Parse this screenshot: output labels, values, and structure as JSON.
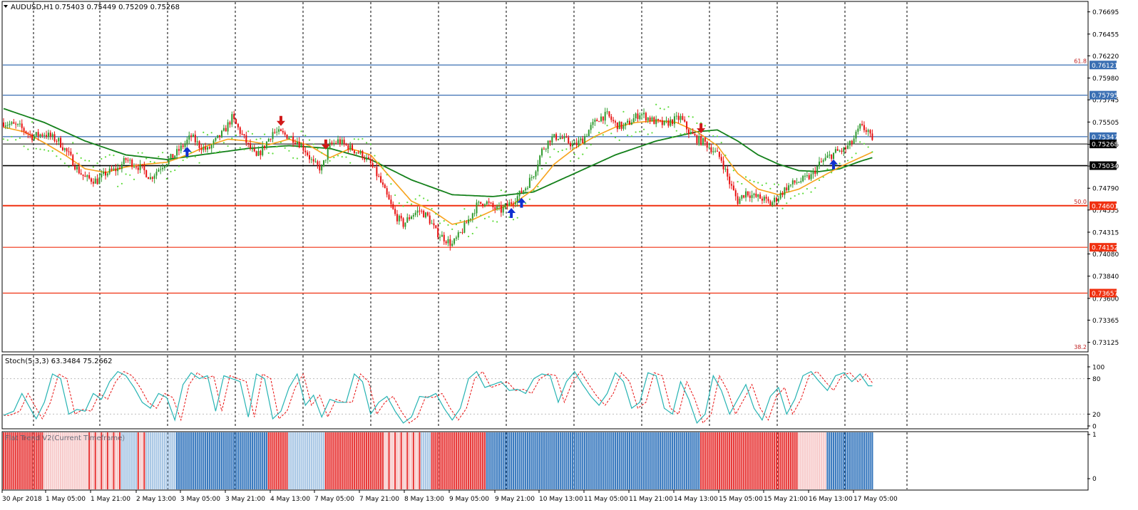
{
  "header": {
    "symbol": "AUDUSD,H1",
    "ohlc": "0.75403 0.75449 0.75209 0.75268"
  },
  "colors": {
    "bull": "#2e9a2e",
    "bear": "#e81010",
    "ma_fast": "#f7a21b",
    "ma_slow": "#13801a",
    "blue_level": "#3a6fb3",
    "red_level": "#f03010",
    "stoch_main": "#26b3b3",
    "stoch_signal": "#e81010",
    "flat_red": "#e83a3a",
    "flat_blue": "#3a7abf",
    "flat_pale": "#f7caca",
    "flat_paleblue": "#a9c7e5",
    "arrow_up": "#1030d0",
    "arrow_down": "#d01818",
    "sar": "#5fdc3c"
  },
  "chart_data": {
    "type": "line",
    "title": "AUDUSD,H1",
    "y_range": [
      0.7303,
      0.768
    ],
    "price_ticks": [
      "0.76695",
      "0.76455",
      "0.76220",
      "0.75980",
      "0.75745",
      "0.75505",
      "0.75265",
      "0.75030",
      "0.74790",
      "0.74555",
      "0.74315",
      "0.74080",
      "0.73840",
      "0.73600",
      "0.73365",
      "0.73125"
    ],
    "x_tick_labels": [
      "30 Apr 2018",
      "1 May 05:00",
      "1 May 21:00",
      "2 May 13:00",
      "3 May 05:00",
      "3 May 21:00",
      "4 May 13:00",
      "7 May 05:00",
      "7 May 21:00",
      "8 May 13:00",
      "9 May 05:00",
      "9 May 21:00",
      "10 May 13:00",
      "11 May 05:00",
      "11 May 21:00",
      "14 May 13:00",
      "15 May 05:00",
      "15 May 21:00",
      "16 May 13:00",
      "17 May 05:00"
    ],
    "levels": [
      {
        "price": 0.76121,
        "label": "0.76121",
        "color": "blue",
        "fib": "61.8"
      },
      {
        "price": 0.75795,
        "label": "0.75795",
        "color": "blue"
      },
      {
        "price": 0.75347,
        "label": "0.75347",
        "color": "blue"
      },
      {
        "price": 0.75268,
        "label": "0.75268",
        "color": "current"
      },
      {
        "price": 0.75034,
        "label": "0.75034",
        "color": "black"
      },
      {
        "price": 0.74601,
        "label": "0.74601",
        "color": "red",
        "fib": "50.0"
      },
      {
        "price": 0.74152,
        "label": "0.74152",
        "color": "red"
      },
      {
        "price": 0.73657,
        "label": "0.73657",
        "color": "red"
      }
    ],
    "fib_bottom_label": "38.2",
    "path": [
      [
        0,
        0.755
      ],
      [
        8,
        0.7545
      ],
      [
        14,
        0.7535
      ],
      [
        20,
        0.7538
      ],
      [
        27,
        0.753
      ],
      [
        32,
        0.7515
      ],
      [
        36,
        0.75
      ],
      [
        40,
        0.749
      ],
      [
        46,
        0.7487
      ],
      [
        50,
        0.7495
      ],
      [
        56,
        0.75
      ],
      [
        60,
        0.751
      ],
      [
        64,
        0.7505
      ],
      [
        68,
        0.75
      ],
      [
        72,
        0.749
      ],
      [
        76,
        0.75
      ],
      [
        80,
        0.7508
      ],
      [
        84,
        0.7515
      ],
      [
        88,
        0.7525
      ],
      [
        92,
        0.7535
      ],
      [
        96,
        0.7525
      ],
      [
        100,
        0.752
      ],
      [
        104,
        0.753
      ],
      [
        108,
        0.754
      ],
      [
        112,
        0.7555
      ],
      [
        116,
        0.754
      ],
      [
        120,
        0.7525
      ],
      [
        124,
        0.7512
      ],
      [
        128,
        0.7525
      ],
      [
        132,
        0.754
      ],
      [
        136,
        0.7538
      ],
      [
        140,
        0.7535
      ],
      [
        144,
        0.753
      ],
      [
        148,
        0.752
      ],
      [
        152,
        0.7505
      ],
      [
        156,
        0.75
      ],
      [
        160,
        0.7525
      ],
      [
        164,
        0.753
      ],
      [
        168,
        0.7525
      ],
      [
        172,
        0.752
      ],
      [
        176,
        0.7515
      ],
      [
        180,
        0.7505
      ],
      [
        184,
        0.749
      ],
      [
        188,
        0.747
      ],
      [
        192,
        0.745
      ],
      [
        196,
        0.744
      ],
      [
        200,
        0.745
      ],
      [
        204,
        0.7455
      ],
      [
        208,
        0.7448
      ],
      [
        212,
        0.7432
      ],
      [
        216,
        0.7425
      ],
      [
        220,
        0.7418
      ],
      [
        224,
        0.743
      ],
      [
        228,
        0.7445
      ],
      [
        232,
        0.746
      ],
      [
        236,
        0.7465
      ],
      [
        240,
        0.7458
      ],
      [
        244,
        0.7455
      ],
      [
        248,
        0.7462
      ],
      [
        252,
        0.747
      ],
      [
        256,
        0.748
      ],
      [
        260,
        0.7495
      ],
      [
        264,
        0.752
      ],
      [
        268,
        0.7532
      ],
      [
        272,
        0.7535
      ],
      [
        276,
        0.753
      ],
      [
        280,
        0.7525
      ],
      [
        284,
        0.7532
      ],
      [
        288,
        0.7545
      ],
      [
        292,
        0.7555
      ],
      [
        296,
        0.7558
      ],
      [
        300,
        0.7548
      ],
      [
        304,
        0.7545
      ],
      [
        308,
        0.7552
      ],
      [
        312,
        0.756
      ],
      [
        316,
        0.7555
      ],
      [
        320,
        0.755
      ],
      [
        324,
        0.7548
      ],
      [
        328,
        0.7552
      ],
      [
        332,
        0.7555
      ],
      [
        336,
        0.754
      ],
      [
        340,
        0.7532
      ],
      [
        344,
        0.7528
      ],
      [
        348,
        0.752
      ],
      [
        352,
        0.751
      ],
      [
        356,
        0.7485
      ],
      [
        360,
        0.7465
      ],
      [
        364,
        0.7475
      ],
      [
        368,
        0.747
      ],
      [
        372,
        0.7468
      ],
      [
        376,
        0.7462
      ],
      [
        380,
        0.747
      ],
      [
        384,
        0.748
      ],
      [
        388,
        0.7485
      ],
      [
        392,
        0.7488
      ],
      [
        396,
        0.7492
      ],
      [
        400,
        0.7505
      ],
      [
        404,
        0.7512
      ],
      [
        408,
        0.7518
      ],
      [
        412,
        0.752
      ],
      [
        416,
        0.7528
      ],
      [
        420,
        0.7545
      ],
      [
        424,
        0.7541
      ],
      [
        426,
        0.7527
      ]
    ],
    "bars": 427,
    "ma_fast": [
      [
        0,
        0.7545
      ],
      [
        10,
        0.754
      ],
      [
        20,
        0.7528
      ],
      [
        30,
        0.7515
      ],
      [
        40,
        0.75
      ],
      [
        50,
        0.7496
      ],
      [
        60,
        0.7502
      ],
      [
        70,
        0.7505
      ],
      [
        80,
        0.7507
      ],
      [
        90,
        0.7515
      ],
      [
        100,
        0.7525
      ],
      [
        110,
        0.7532
      ],
      [
        120,
        0.753
      ],
      [
        130,
        0.7526
      ],
      [
        140,
        0.7532
      ],
      [
        150,
        0.7525
      ],
      [
        160,
        0.7512
      ],
      [
        170,
        0.7522
      ],
      [
        180,
        0.7515
      ],
      [
        190,
        0.749
      ],
      [
        200,
        0.7465
      ],
      [
        210,
        0.7455
      ],
      [
        220,
        0.744
      ],
      [
        230,
        0.7445
      ],
      [
        240,
        0.7455
      ],
      [
        250,
        0.7462
      ],
      [
        260,
        0.7478
      ],
      [
        270,
        0.7505
      ],
      [
        280,
        0.7522
      ],
      [
        290,
        0.7535
      ],
      [
        300,
        0.7545
      ],
      [
        310,
        0.755
      ],
      [
        320,
        0.7552
      ],
      [
        330,
        0.755
      ],
      [
        340,
        0.754
      ],
      [
        350,
        0.7525
      ],
      [
        360,
        0.7495
      ],
      [
        370,
        0.7478
      ],
      [
        380,
        0.7472
      ],
      [
        390,
        0.7478
      ],
      [
        400,
        0.749
      ],
      [
        410,
        0.7502
      ],
      [
        420,
        0.7512
      ],
      [
        426,
        0.7518
      ]
    ],
    "ma_slow": [
      [
        0,
        0.7565
      ],
      [
        20,
        0.755
      ],
      [
        40,
        0.753
      ],
      [
        60,
        0.7515
      ],
      [
        80,
        0.751
      ],
      [
        100,
        0.7516
      ],
      [
        120,
        0.7522
      ],
      [
        140,
        0.7525
      ],
      [
        160,
        0.7522
      ],
      [
        180,
        0.751
      ],
      [
        200,
        0.7488
      ],
      [
        220,
        0.7472
      ],
      [
        240,
        0.747
      ],
      [
        260,
        0.7475
      ],
      [
        280,
        0.7495
      ],
      [
        300,
        0.7515
      ],
      [
        320,
        0.753
      ],
      [
        340,
        0.754
      ],
      [
        350,
        0.7542
      ],
      [
        360,
        0.753
      ],
      [
        370,
        0.7515
      ],
      [
        380,
        0.7505
      ],
      [
        390,
        0.7498
      ],
      [
        400,
        0.7497
      ],
      [
        410,
        0.75
      ],
      [
        420,
        0.7508
      ],
      [
        426,
        0.7512
      ]
    ],
    "arrows": [
      {
        "bar": 90,
        "dir": "up"
      },
      {
        "bar": 136,
        "dir": "down"
      },
      {
        "bar": 158,
        "dir": "down"
      },
      {
        "bar": 249,
        "dir": "up"
      },
      {
        "bar": 254,
        "dir": "up"
      },
      {
        "bar": 342,
        "dir": "down"
      },
      {
        "bar": 407,
        "dir": "up"
      }
    ],
    "stochastic": {
      "label": "Stoch(5,3,3) 63.3484 75.2662",
      "y_range": [
        0,
        100
      ],
      "ticks": [
        "100",
        "80",
        "20",
        "0"
      ],
      "levels": [
        80,
        20
      ],
      "main": [
        [
          0,
          18
        ],
        [
          5,
          25
        ],
        [
          9,
          55
        ],
        [
          13,
          30
        ],
        [
          16,
          12
        ],
        [
          20,
          40
        ],
        [
          24,
          88
        ],
        [
          28,
          80
        ],
        [
          32,
          20
        ],
        [
          36,
          28
        ],
        [
          40,
          25
        ],
        [
          44,
          55
        ],
        [
          48,
          45
        ],
        [
          52,
          75
        ],
        [
          56,
          92
        ],
        [
          60,
          85
        ],
        [
          64,
          65
        ],
        [
          68,
          40
        ],
        [
          72,
          30
        ],
        [
          76,
          55
        ],
        [
          80,
          48
        ],
        [
          84,
          10
        ],
        [
          88,
          70
        ],
        [
          92,
          90
        ],
        [
          96,
          80
        ],
        [
          100,
          85
        ],
        [
          104,
          25
        ],
        [
          108,
          85
        ],
        [
          112,
          80
        ],
        [
          116,
          75
        ],
        [
          120,
          15
        ],
        [
          124,
          88
        ],
        [
          128,
          80
        ],
        [
          132,
          12
        ],
        [
          136,
          25
        ],
        [
          140,
          65
        ],
        [
          144,
          88
        ],
        [
          148,
          35
        ],
        [
          152,
          52
        ],
        [
          156,
          15
        ],
        [
          160,
          45
        ],
        [
          164,
          40
        ],
        [
          168,
          40
        ],
        [
          172,
          88
        ],
        [
          176,
          75
        ],
        [
          180,
          20
        ],
        [
          184,
          40
        ],
        [
          188,
          50
        ],
        [
          192,
          25
        ],
        [
          196,
          5
        ],
        [
          200,
          15
        ],
        [
          204,
          50
        ],
        [
          208,
          48
        ],
        [
          212,
          55
        ],
        [
          216,
          30
        ],
        [
          220,
          10
        ],
        [
          224,
          30
        ],
        [
          228,
          80
        ],
        [
          232,
          92
        ],
        [
          236,
          65
        ],
        [
          240,
          70
        ],
        [
          244,
          75
        ],
        [
          248,
          60
        ],
        [
          252,
          62
        ],
        [
          256,
          55
        ],
        [
          260,
          80
        ],
        [
          264,
          88
        ],
        [
          268,
          85
        ],
        [
          272,
          40
        ],
        [
          276,
          75
        ],
        [
          280,
          92
        ],
        [
          284,
          70
        ],
        [
          288,
          50
        ],
        [
          292,
          35
        ],
        [
          296,
          55
        ],
        [
          300,
          90
        ],
        [
          304,
          75
        ],
        [
          308,
          30
        ],
        [
          312,
          40
        ],
        [
          316,
          90
        ],
        [
          320,
          85
        ],
        [
          324,
          30
        ],
        [
          328,
          20
        ],
        [
          332,
          75
        ],
        [
          336,
          45
        ],
        [
          340,
          5
        ],
        [
          344,
          20
        ],
        [
          348,
          85
        ],
        [
          352,
          60
        ],
        [
          356,
          20
        ],
        [
          360,
          45
        ],
        [
          364,
          70
        ],
        [
          368,
          30
        ],
        [
          372,
          10
        ],
        [
          376,
          50
        ],
        [
          380,
          65
        ],
        [
          384,
          20
        ],
        [
          388,
          45
        ],
        [
          392,
          85
        ],
        [
          396,
          92
        ],
        [
          400,
          75
        ],
        [
          404,
          60
        ],
        [
          408,
          85
        ],
        [
          412,
          90
        ],
        [
          416,
          75
        ],
        [
          420,
          88
        ],
        [
          424,
          68
        ]
      ]
    },
    "flat_trend": {
      "label": "Flat Trend V2(Current Timeframe)",
      "ticks": [
        "1",
        "0"
      ],
      "segments": [
        [
          0,
          20,
          "red"
        ],
        [
          20,
          40,
          "pale"
        ],
        [
          40,
          58,
          "mix"
        ],
        [
          58,
          66,
          "paleblue"
        ],
        [
          66,
          70,
          "mix"
        ],
        [
          70,
          85,
          "paleblue"
        ],
        [
          85,
          130,
          "blue"
        ],
        [
          130,
          140,
          "red"
        ],
        [
          140,
          158,
          "paleblue"
        ],
        [
          158,
          186,
          "red"
        ],
        [
          186,
          205,
          "mix"
        ],
        [
          205,
          210,
          "paleblue"
        ],
        [
          210,
          237,
          "red"
        ],
        [
          237,
          342,
          "blue"
        ],
        [
          342,
          390,
          "red"
        ],
        [
          390,
          404,
          "pale"
        ],
        [
          404,
          427,
          "blue"
        ]
      ]
    }
  }
}
